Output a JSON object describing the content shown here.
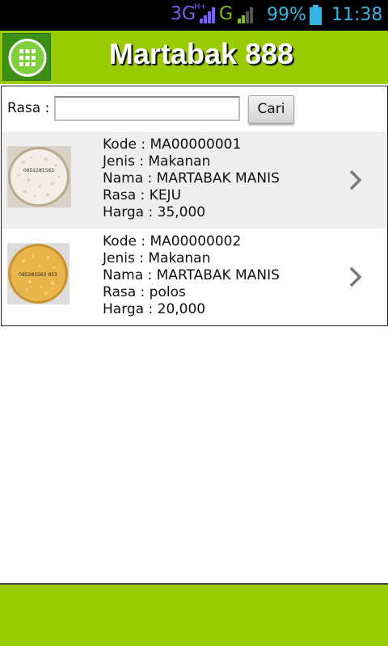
{
  "status_bar": {
    "network": "3G",
    "network_sub": "H+",
    "network2": "G",
    "battery": "99%",
    "time": "11:38",
    "colors": {
      "text": "#33b5e5",
      "network": "#7b5cff",
      "g": "#7ec500"
    }
  },
  "header": {
    "title": "Martabak 888",
    "menu_icon": "grid-menu-icon",
    "bg_color": "#99cc00"
  },
  "search": {
    "label": "Rasa :",
    "value": "",
    "placeholder": "",
    "button_label": "Cari"
  },
  "items": [
    {
      "kode": "Kode : MA00000001",
      "jenis": "Jenis : Makanan",
      "nama": "Nama : MARTABAK MANIS",
      "rasa": "Rasa : KEJU",
      "harga": "Harga : 35,000",
      "image_icon": "martabak-keju-photo",
      "image_text": "0851281563",
      "chevron_icon": "chevron-right-icon"
    },
    {
      "kode": "Kode : MA00000002",
      "jenis": "Jenis : Makanan",
      "nama": "Nama : MARTABAK MANIS",
      "rasa": "Rasa : polos",
      "harga": "Harga : 20,000",
      "image_icon": "martabak-polos-photo",
      "image_text": "085281563 953",
      "chevron_icon": "chevron-right-icon"
    }
  ]
}
